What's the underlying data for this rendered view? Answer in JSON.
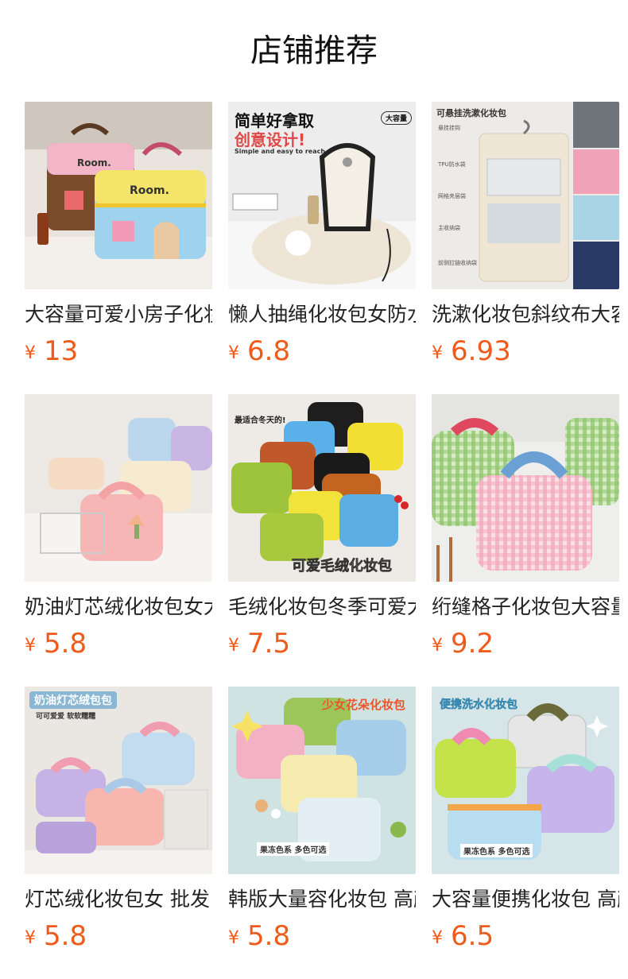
{
  "header": {
    "title": "店铺推荐"
  },
  "theme": {
    "price_color": "#f05a1a"
  },
  "products": [
    {
      "name": "大容量可爱小房子化妆包",
      "currency": "¥",
      "price": "13",
      "image_text": {
        "a": "Room.",
        "b": "Room."
      }
    },
    {
      "name": "懒人抽绳化妆包女防水",
      "currency": "¥",
      "price": "6.8",
      "image_text": {
        "a": "简单好拿取",
        "b": "创意设计!",
        "c": "Simple and easy to reach",
        "d": "大容量"
      }
    },
    {
      "name": "洗漱化妆包斜纹布大容量",
      "currency": "¥",
      "price": "6.93",
      "image_text": {
        "a": "可悬挂洗漱化妆包",
        "b": "悬挂挂钩",
        "c": "TPU防水袋",
        "d": "网格夹层袋",
        "e": "主收纳袋",
        "f": "前侧拉链收纳袋"
      }
    },
    {
      "name": "奶油灯芯绒化妆包女大容量",
      "currency": "¥",
      "price": "5.8",
      "image_text": {}
    },
    {
      "name": "毛绒化妆包冬季可爱大容量",
      "currency": "¥",
      "price": "7.5",
      "image_text": {
        "a": "最适合冬天的!",
        "b": "可爱毛绒化妆包"
      }
    },
    {
      "name": "绗缝格子化妆包大容量",
      "currency": "¥",
      "price": "9.2",
      "image_text": {}
    },
    {
      "name": "灯芯绒化妆包女 批发",
      "currency": "¥",
      "price": "5.8",
      "image_text": {
        "a": "奶油灯芯绒包包",
        "b": "可可爱爱 软软糯糯"
      }
    },
    {
      "name": "韩版大量容化妆包 高颜值",
      "currency": "¥",
      "price": "5.8",
      "image_text": {
        "a": "少女花朵化妆包",
        "b": "果冻色系 多色可选"
      }
    },
    {
      "name": "大容量便携化妆包 高颜值",
      "currency": "¥",
      "price": "6.5",
      "image_text": {
        "a": "便携洗水化妆包",
        "b": "果冻色系 多色可选"
      }
    }
  ]
}
